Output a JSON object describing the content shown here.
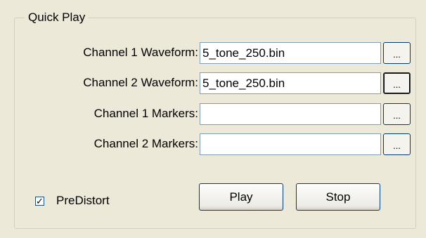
{
  "group": {
    "title": "Quick Play"
  },
  "rows": [
    {
      "label": "Channel 1 Waveform:",
      "value": "5_tone_250.bin",
      "browse": "..."
    },
    {
      "label": "Channel 2 Waveform:",
      "value": "5_tone_250.bin",
      "browse": "..."
    },
    {
      "label": "Channel 1 Markers:",
      "value": "",
      "browse": "..."
    },
    {
      "label": "Channel 2 Markers:",
      "value": "",
      "browse": "..."
    }
  ],
  "predistort": {
    "label": "PreDistort",
    "checked": true,
    "mark": "✓"
  },
  "buttons": {
    "play": "Play",
    "stop": "Stop"
  }
}
